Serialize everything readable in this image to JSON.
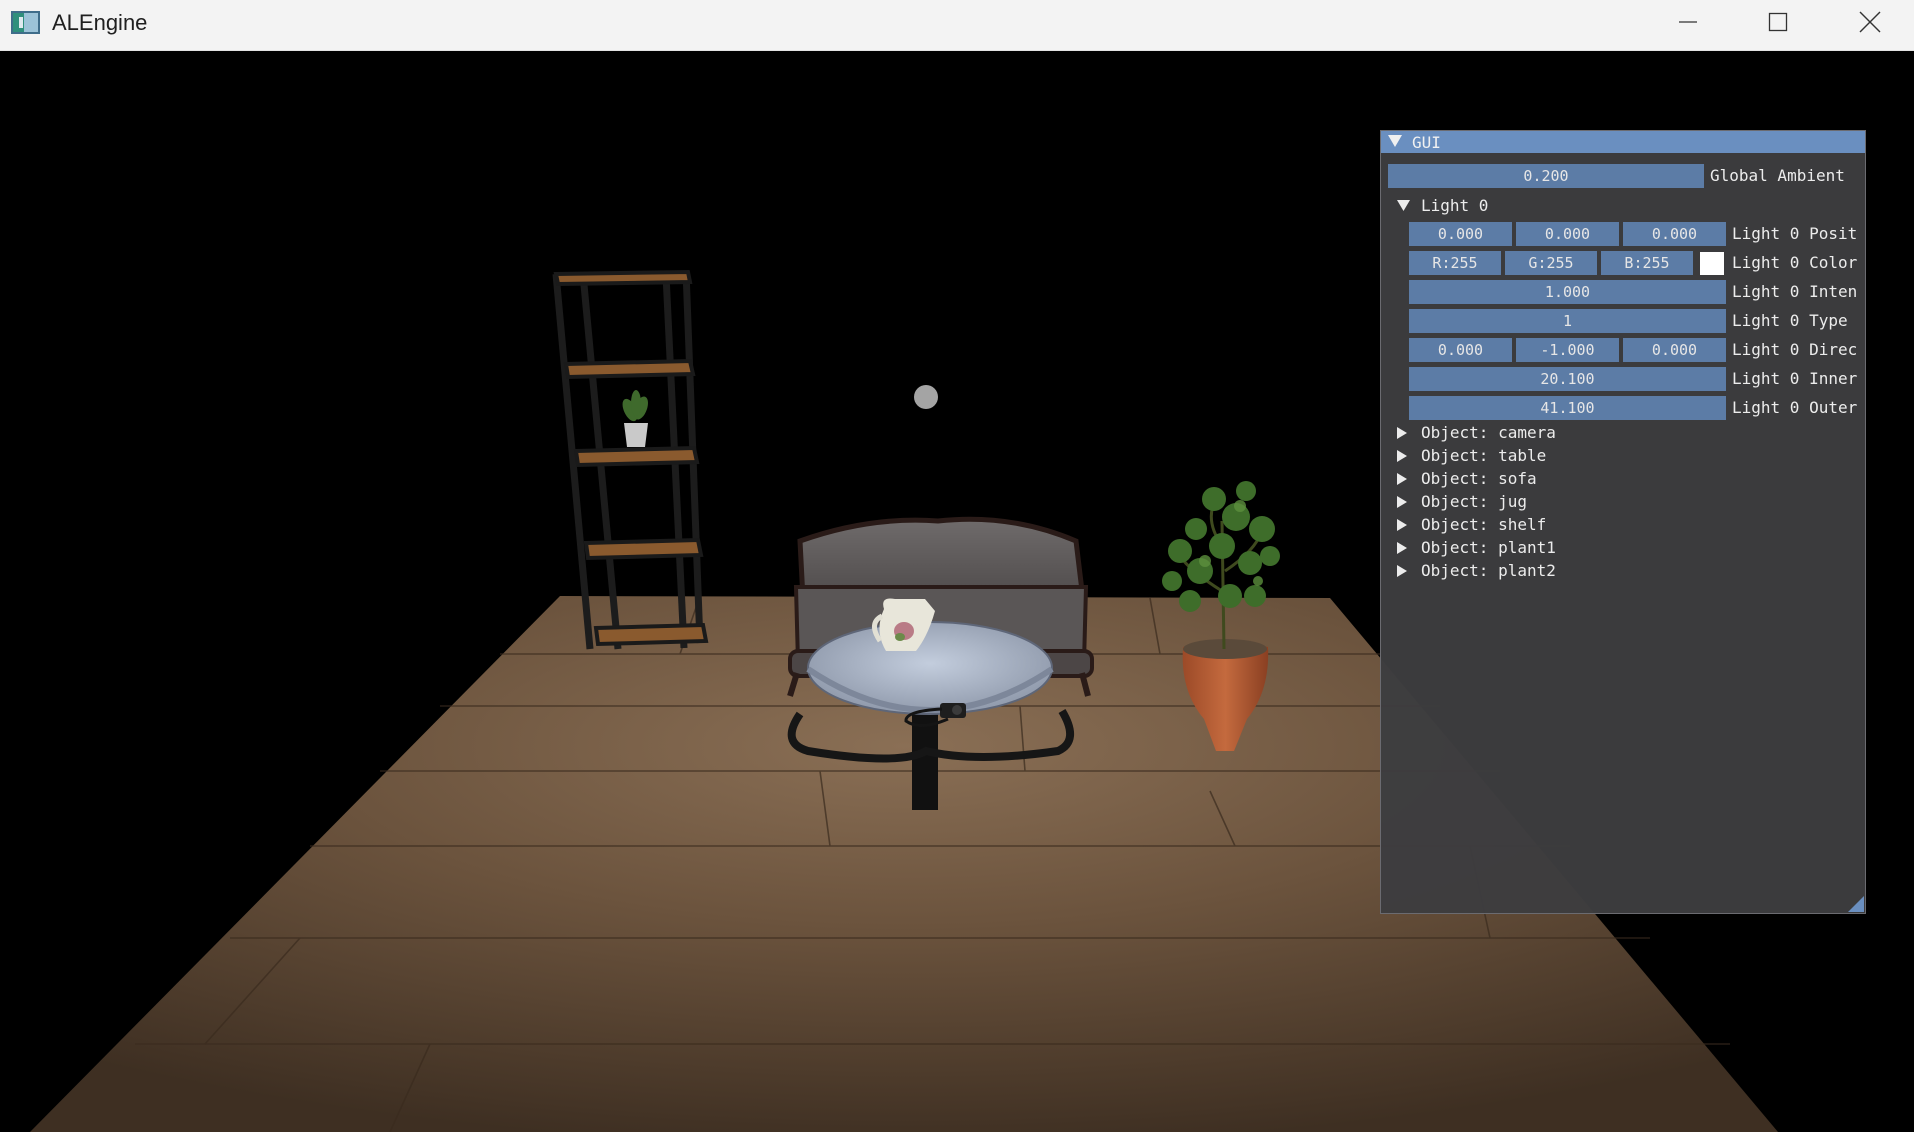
{
  "window": {
    "title": "ALEngine",
    "app_icon": "app-window-icon",
    "controls": {
      "minimize": "minimize-icon",
      "maximize": "maximize-icon",
      "close": "close-icon"
    }
  },
  "gui": {
    "title": "GUI",
    "accent_color": "#6a8fc0",
    "field_color": "#5c7ca6",
    "global_ambient": {
      "value": "0.200",
      "label": "Global Ambient"
    },
    "light0": {
      "header": "Light 0",
      "position": {
        "x": "0.000",
        "y": "0.000",
        "z": "0.000",
        "label": "Light 0 Posit"
      },
      "color": {
        "r": "R:255",
        "g": "G:255",
        "b": "B:255",
        "label": "Light 0 Color",
        "swatch": "#ffffff"
      },
      "intensity": {
        "value": "1.000",
        "label": "Light 0 Inten"
      },
      "type": {
        "value": "1",
        "label": "Light 0 Type"
      },
      "direction": {
        "x": "0.000",
        "y": "-1.000",
        "z": "0.000",
        "label": "Light 0 Direc"
      },
      "inner": {
        "value": "20.100",
        "label": "Light 0 Inner"
      },
      "outer": {
        "value": "41.100",
        "label": "Light 0 Outer"
      }
    },
    "objects": [
      "Object: camera",
      "Object: table",
      "Object: sofa",
      "Object: jug",
      "Object: shelf",
      "Object: plant1",
      "Object: plant2"
    ]
  }
}
